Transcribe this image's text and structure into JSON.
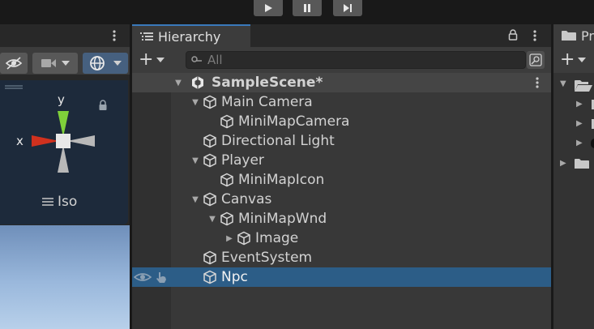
{
  "playmode": {
    "buttons": [
      {
        "name": "play-button",
        "glyph": "▶"
      },
      {
        "name": "pause-button",
        "glyph": "❚❚"
      },
      {
        "name": "step-button",
        "glyph": "▶❙"
      }
    ]
  },
  "scene_view": {
    "gizmo": {
      "y_label": "y",
      "x_label": "x",
      "projection_label": "Iso"
    }
  },
  "hierarchy": {
    "tab_label": "Hierarchy",
    "search_placeholder": "All",
    "add_label": "+",
    "scene_name": "SampleScene*",
    "items": [
      {
        "label": "Main Camera",
        "depth": 1,
        "expanded": true
      },
      {
        "label": "MiniMapCamera",
        "depth": 2,
        "expanded": null
      },
      {
        "label": "Directional Light",
        "depth": 1,
        "expanded": null
      },
      {
        "label": "Player",
        "depth": 1,
        "expanded": true
      },
      {
        "label": "MiniMapIcon",
        "depth": 2,
        "expanded": null
      },
      {
        "label": "Canvas",
        "depth": 1,
        "expanded": true
      },
      {
        "label": "MiniMapWnd",
        "depth": 2,
        "expanded": true
      },
      {
        "label": "Image",
        "depth": 3,
        "expanded": false
      },
      {
        "label": "EventSystem",
        "depth": 1,
        "expanded": null
      },
      {
        "label": "Npc",
        "depth": 1,
        "expanded": null,
        "selected": true
      }
    ]
  },
  "project": {
    "tab_label": "Pr",
    "add_label": "+"
  },
  "colors": {
    "selection": "#2c5d87",
    "tab_accent": "#3a79bb",
    "gizmo_y": "#7fd03a",
    "gizmo_x": "#d0311e"
  }
}
